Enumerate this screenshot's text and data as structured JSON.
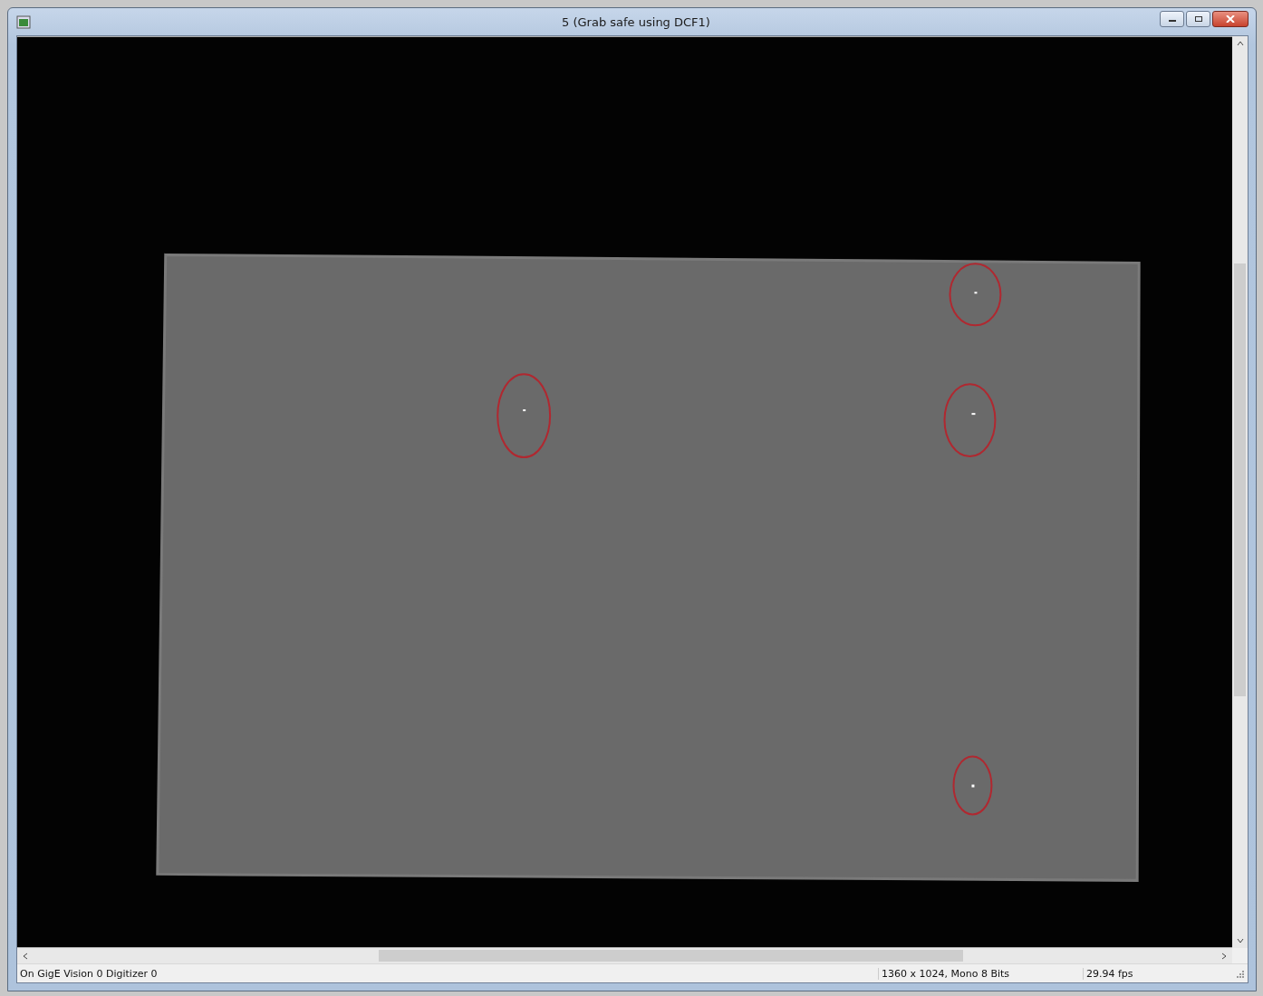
{
  "window": {
    "title": "5 (Grab safe using DCF1)"
  },
  "status_bar": {
    "source": "On GigE Vision 0 Digitizer 0",
    "format": "1360 x 1024, Mono 8 Bits",
    "frame_rate": "29.94 fps"
  }
}
